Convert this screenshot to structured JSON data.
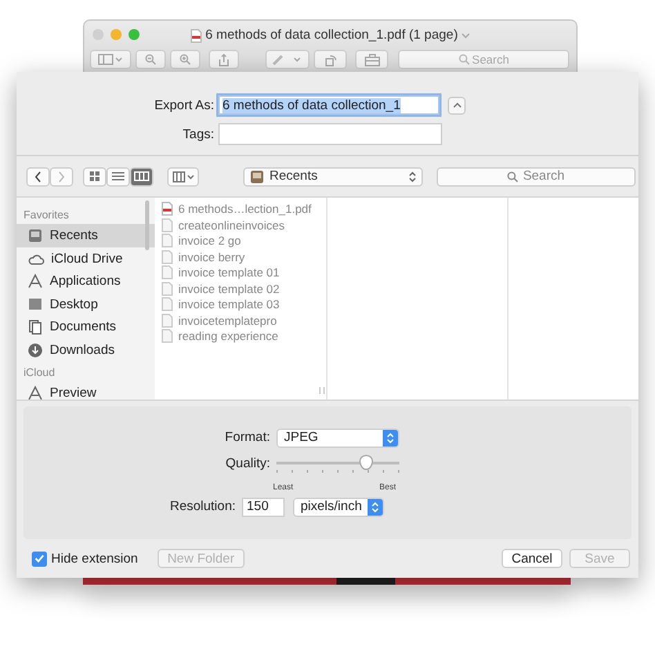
{
  "window": {
    "title": "6 methods of data collection_1.pdf (1 page)",
    "search_placeholder": "Search"
  },
  "export": {
    "export_as_label": "Export As:",
    "filename": "6 methods of data collection_1",
    "tags_label": "Tags:"
  },
  "toolbar": {
    "view_modes": [
      {
        "kind": "icons",
        "selected": false
      },
      {
        "kind": "list",
        "selected": false
      },
      {
        "kind": "columns",
        "selected": true
      }
    ],
    "location": "Recents",
    "search_placeholder": "Search"
  },
  "sidebar": {
    "sections": [
      {
        "title": "Favorites",
        "items": [
          {
            "label": "Recents",
            "kind": "recents",
            "selected": true
          },
          {
            "label": "iCloud Drive",
            "kind": "cloud",
            "selected": false
          },
          {
            "label": "Applications",
            "kind": "apps",
            "selected": false
          },
          {
            "label": "Desktop",
            "kind": "desktop",
            "selected": false
          },
          {
            "label": "Documents",
            "kind": "documents",
            "selected": false
          },
          {
            "label": "Downloads",
            "kind": "downloads",
            "selected": false
          }
        ]
      },
      {
        "title": "iCloud",
        "items": [
          {
            "label": "Preview",
            "kind": "apps",
            "selected": false
          }
        ]
      }
    ]
  },
  "files": [
    {
      "name": "6 methods…lection_1.pdf",
      "kind": "pdf"
    },
    {
      "name": "createonlineinvoices",
      "kind": "doc"
    },
    {
      "name": "invoice 2 go",
      "kind": "doc"
    },
    {
      "name": "invoice berry",
      "kind": "doc"
    },
    {
      "name": "invoice template 01",
      "kind": "doc"
    },
    {
      "name": "invoice template 02",
      "kind": "doc"
    },
    {
      "name": "invoice template 03",
      "kind": "doc"
    },
    {
      "name": "invoicetemplatepro",
      "kind": "doc"
    },
    {
      "name": "reading experience",
      "kind": "doc"
    }
  ],
  "options": {
    "format_label": "Format:",
    "format": "JPEG",
    "quality_label": "Quality:",
    "quality": {
      "level": 0.76
    },
    "least": "Least",
    "best": "Best",
    "resolution_label": "Resolution:",
    "resolution": "150",
    "unit": "pixels/inch"
  },
  "footer": {
    "hide_extension": {
      "label": "Hide extension",
      "checked": true
    },
    "new_folder": {
      "label": "New Folder",
      "disabled": true
    },
    "cancel": {
      "label": "Cancel"
    },
    "save": {
      "label": "Save",
      "disabled": true
    }
  }
}
